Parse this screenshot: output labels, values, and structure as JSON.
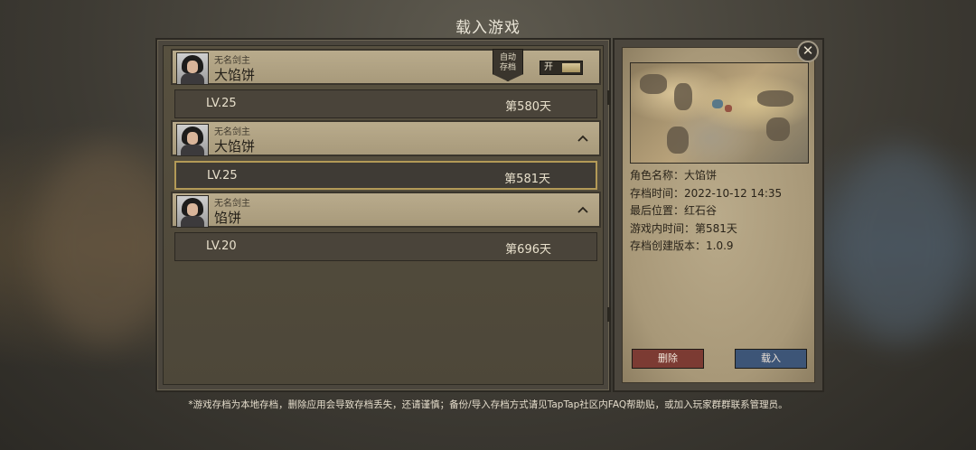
{
  "title": "载入游戏",
  "saves": [
    {
      "subtitle": "无名剑主",
      "name": "大馅饼",
      "level": "LV.25",
      "day": "第580天"
    },
    {
      "subtitle": "无名剑主",
      "name": "大馅饼",
      "level": "LV.25",
      "day": "第581天"
    },
    {
      "subtitle": "无名剑主",
      "name": "馅饼",
      "level": "LV.20",
      "day": "第696天"
    }
  ],
  "autosave": {
    "label_line1": "自动",
    "label_line2": "存档",
    "toggle_label": "开",
    "enabled": true
  },
  "icons": {
    "collapse": "chevron-up-icon",
    "close": "close-icon"
  },
  "details": {
    "character_name": "角色名称：大馅饼",
    "save_time": "存档时间：2022-10-12 14:35",
    "last_location": "最后位置：红石谷",
    "ingame_time": "游戏内时间：第581天",
    "version": "存档创建版本：1.0.9"
  },
  "buttons": {
    "delete": "删除",
    "load": "载入"
  },
  "footer": "*游戏存档为本地存档，删除应用会导致存档丢失，还请谨慎；备份/导入存档方式请见TapTap社区内FAQ帮助贴，或加入玩家群群联系管理员。",
  "colors": {
    "selected_border": "#b39a57",
    "delete_button": "#7c3b33",
    "load_button": "#3d5577"
  }
}
